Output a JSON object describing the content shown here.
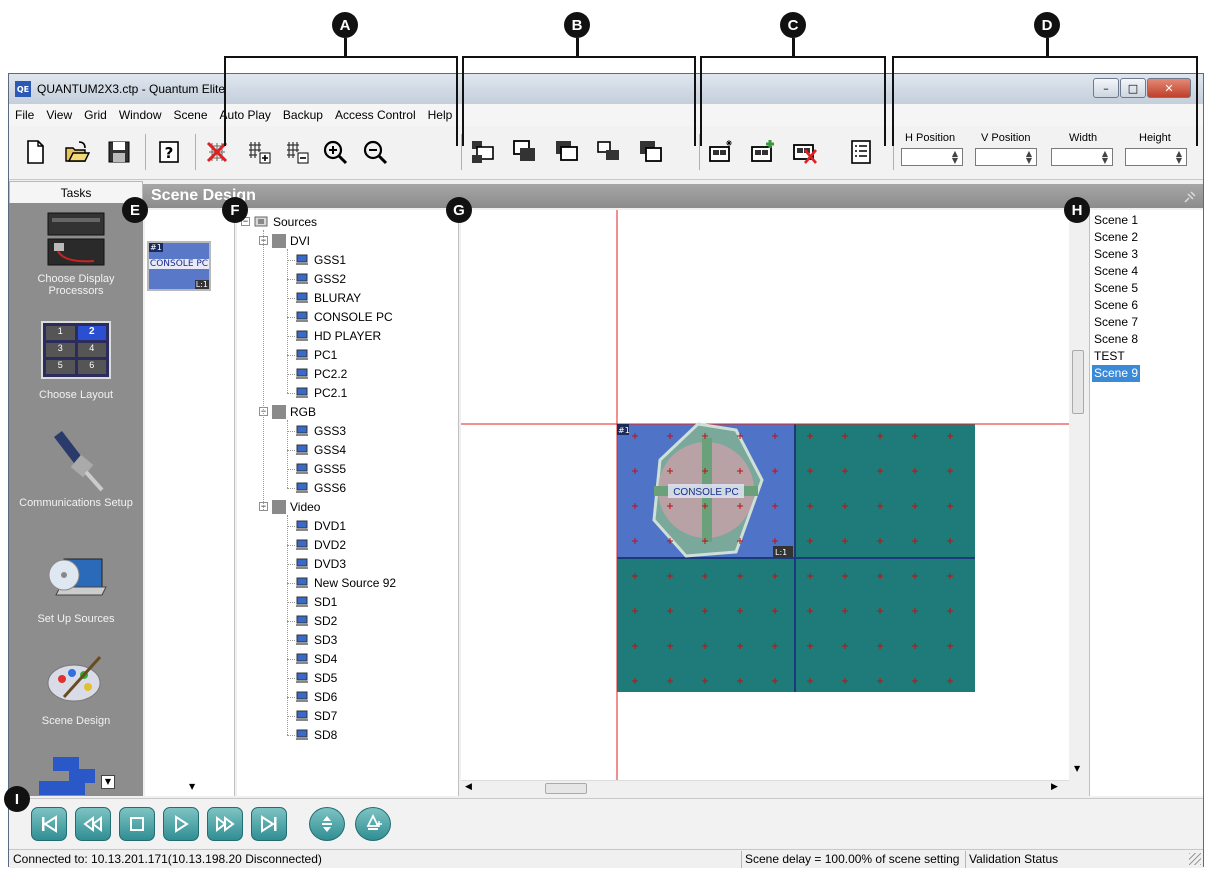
{
  "callouts": [
    "A",
    "B",
    "C",
    "D",
    "E",
    "F",
    "G",
    "H",
    "I"
  ],
  "window": {
    "title": "QUANTUM2X3.ctp - Quantum Elite",
    "app_icon": "QE",
    "controls": [
      "minimize-icon",
      "maximize-icon",
      "close-icon"
    ]
  },
  "menu": [
    "File",
    "View",
    "Grid",
    "Window",
    "Scene",
    "Auto Play",
    "Backup",
    "Access Control",
    "Help"
  ],
  "toolbar": {
    "position_fields": {
      "h_position": "H Position",
      "v_position": "V Position",
      "width": "Width",
      "height": "Height"
    }
  },
  "tasks": {
    "tab": "Tasks",
    "items": [
      {
        "label": "Choose Display Processors",
        "icon": "display-processor-icon"
      },
      {
        "label": "Choose Layout",
        "icon": "layout-icon"
      },
      {
        "label": "Communications Setup",
        "icon": "connector-icon"
      },
      {
        "label": "Set Up Sources",
        "icon": "laptop-cd-icon"
      },
      {
        "label": "Scene Design",
        "icon": "palette-icon"
      }
    ],
    "layout_cells": [
      "1",
      "2",
      "3",
      "4",
      "5",
      "6"
    ]
  },
  "panel": {
    "title": "Scene Design"
  },
  "thumbnail": {
    "index": "#1",
    "label": "CONSOLE PC",
    "layer": "L:1"
  },
  "tree": {
    "root": "Sources",
    "groups": [
      {
        "name": "DVI",
        "items": [
          "GSS1",
          "GSS2",
          "BLURAY",
          "CONSOLE PC",
          "HD PLAYER",
          "PC1",
          "PC2.2",
          "PC2.1"
        ]
      },
      {
        "name": "RGB",
        "items": [
          "GSS3",
          "GSS4",
          "GSS5",
          "GSS6"
        ]
      },
      {
        "name": "Video",
        "items": [
          "DVD1",
          "DVD2",
          "DVD3",
          "New Source 92",
          "SD1",
          "SD2",
          "SD3",
          "SD4",
          "SD5",
          "SD6",
          "SD7",
          "SD8"
        ]
      }
    ]
  },
  "canvas": {
    "window_index": "#1",
    "window_label": "CONSOLE PC",
    "window_layer": "L:1",
    "colors": {
      "wall": "#1f7a7a",
      "window": "#4f73c6",
      "guide": "#e02020"
    }
  },
  "scenes": {
    "items": [
      "Scene 1",
      "Scene 2",
      "Scene 3",
      "Scene 4",
      "Scene 5",
      "Scene 6",
      "Scene 7",
      "Scene 8",
      "TEST",
      "Scene 9"
    ],
    "selected": "Scene 9"
  },
  "status": {
    "connection": "Connected to: 10.13.201.171(10.13.198.20 Disconnected)",
    "scene_delay": "Scene delay = 100.00% of scene setting",
    "validation": "Validation Status"
  }
}
